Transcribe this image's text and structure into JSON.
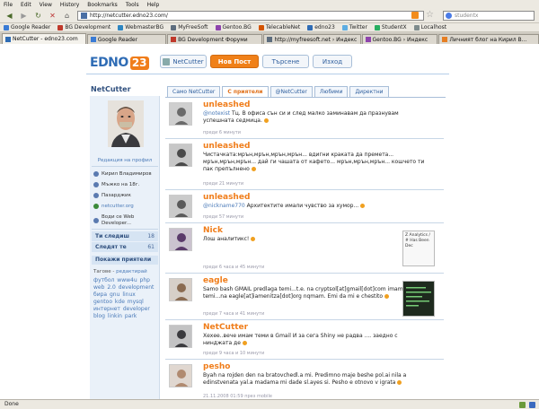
{
  "browser": {
    "menu": [
      "File",
      "Edit",
      "View",
      "History",
      "Bookmarks",
      "Tools",
      "Help"
    ],
    "url": "http://netcutter.edno23.com/",
    "search_placeholder": "studentx",
    "bookmarks": [
      {
        "label": "Google Reader",
        "color": "#3a7bd5"
      },
      {
        "label": "BG Development",
        "color": "#c0392b"
      },
      {
        "label": "WebmasterBG",
        "color": "#2e86c1"
      },
      {
        "label": "MyFreeSoft",
        "color": "#5d6d7e"
      },
      {
        "label": "Gentoo.BG",
        "color": "#8e44ad"
      },
      {
        "label": "TelecableNet",
        "color": "#d35400"
      },
      {
        "label": "edno23",
        "color": "#2f6cb5"
      },
      {
        "label": "Twitter",
        "color": "#5dade2"
      },
      {
        "label": "StudentX",
        "color": "#27ae60"
      },
      {
        "label": "Localhost",
        "color": "#7f8c8d"
      }
    ],
    "tabs": [
      {
        "label": "NetCutter - edno23.com",
        "active": true
      },
      {
        "label": "Google Reader",
        "active": false
      },
      {
        "label": "BG Development Форуми",
        "active": false
      },
      {
        "label": "http://myfreesoft.net › Индекс",
        "active": false
      },
      {
        "label": "Gentoo.BG › Индекс",
        "active": false
      },
      {
        "label": "Личният блог на Кирил В...",
        "active": false
      }
    ],
    "status": "Done"
  },
  "site": {
    "logo_text": "EDNO",
    "logo_num": "23",
    "nav": {
      "user": "NetCutter",
      "new_post": "Нов Пост",
      "search": "Търсене",
      "exit": "Изход"
    }
  },
  "profile": {
    "username": "NetCutter",
    "edit_profile": "Редакция на профил",
    "details": [
      {
        "text": "Кирил Владимиров",
        "icon": "user-icon"
      },
      {
        "text": "Мъжко на 18г.",
        "icon": "gender-icon"
      },
      {
        "text": "Пазарджик",
        "icon": "location-icon"
      },
      {
        "text": "netcutter.org",
        "icon": "globe-icon"
      },
      {
        "text": "Води се Web Developer...",
        "icon": "info-icon"
      }
    ],
    "following_label": "Ти следиш",
    "following_count": "18",
    "followers_label": "Следят те",
    "followers_count": "61",
    "show_friends": "Покажи приятели",
    "tags_label": "Тагове",
    "tags_edit": "редактирай",
    "tags": "футбол www4u php web 2.0 development бира gnu linux gentoo kde mysql интернет developer blog linkin park"
  },
  "feed": {
    "tabs": [
      {
        "label": "Само NetCutter",
        "active": false
      },
      {
        "label": "С приятели",
        "active": true
      },
      {
        "label": "@NetCutter",
        "active": false
      },
      {
        "label": "Любими",
        "active": false
      },
      {
        "label": "Директни",
        "active": false
      }
    ],
    "posts": [
      {
        "name": "unleashed",
        "mention": "@notexist",
        "text": "Тц. В офиса сън си и след малко заминавам да празнувам успешната седмица.",
        "time": "преди 6 минути"
      },
      {
        "name": "unleashed",
        "mention": "",
        "text": "Чистачката:мрън,мрън,мрън,мрън... вдигни краката да премета... мрън,мрън,мрън... дай ги чашата от кафето... мрън,мрън,мрън... кошчето ти пак препълнено",
        "time": "преди 21 минути"
      },
      {
        "name": "unleashed",
        "mention": "@nickname770",
        "text": "Архитектите имали чувство за хумор...",
        "time": "преди 57 минути"
      },
      {
        "name": "Nick",
        "mention": "",
        "text": "Лош аналитикс!",
        "time": "преди 6 часа и 45 минути",
        "thumb": "Z Analytics / # Has Been Dec"
      },
      {
        "name": "eagle",
        "mention": "",
        "text": "Samo bash GMAIL predlaga temi...t.e. na cryptsol[at]gmail[dot]com imam temi...na eagle[at]iamenitza[dot]org nqmam. Emi da mi e chestito",
        "time": "преди 7 часа и 41 минути"
      },
      {
        "name": "NetCutter",
        "mention": "",
        "text": "Хехее..вече имам теми в Gmail И за сега Shiny не радва .... заедно с нинджата де",
        "time": "преди 9 часа и 10 минути"
      },
      {
        "name": "pesho",
        "mention": "",
        "text": "Byah na rojden den na bratovchedl.a mi. Predimno maje beshe pol.ai nila a edinstvenata yal.a madama mi dade sl.ayes si. Pesho e otnovo v igrata",
        "time": "21.11.2008 01:59 през mobile"
      }
    ]
  }
}
